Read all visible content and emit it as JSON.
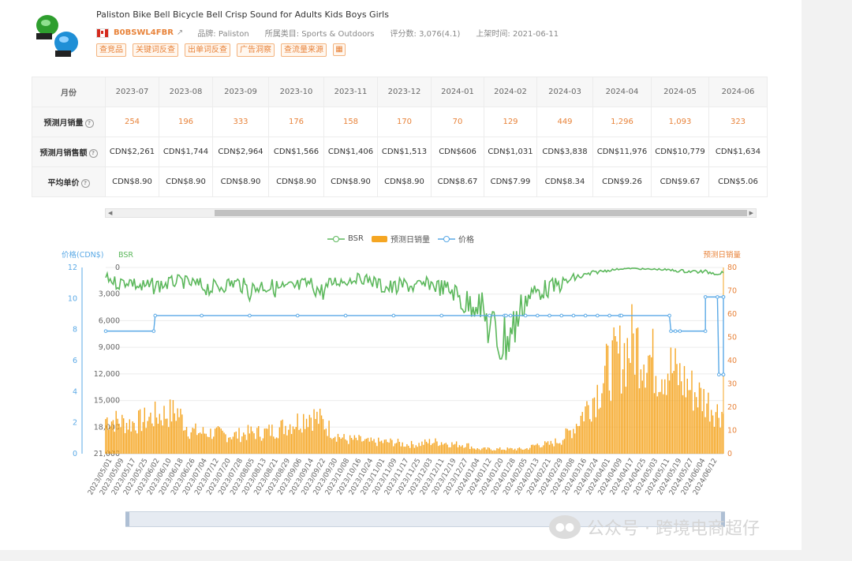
{
  "product": {
    "title": "Paliston Bike Bell Bicycle Bell Crisp Sound for Adults Kids Boys Girls",
    "asin": "B0BSWL4FBR",
    "brand": "品牌: Paliston",
    "category": "所属类目: Sports & Outdoors",
    "rating": "评分数: 3,076(4.1)",
    "listed": "上架时间: 2021-06-11",
    "tags": [
      "查竞品",
      "关键词反查",
      "出单词反查",
      "广告洞察",
      "查流量来源"
    ]
  },
  "table": {
    "header_label": "月份",
    "months": [
      "2023-07",
      "2023-08",
      "2023-09",
      "2023-10",
      "2023-11",
      "2023-12",
      "2024-01",
      "2024-02",
      "2024-03",
      "2024-04",
      "2024-05",
      "2024-06"
    ],
    "rows": [
      {
        "label": "预测月销量",
        "values": [
          "254",
          "196",
          "333",
          "176",
          "158",
          "170",
          "70",
          "129",
          "449",
          "1,296",
          "1,093",
          "323"
        ]
      },
      {
        "label": "预测月销售额",
        "values": [
          "CDN$2,261",
          "CDN$1,744",
          "CDN$2,964",
          "CDN$1,566",
          "CDN$1,406",
          "CDN$1,513",
          "CDN$606",
          "CDN$1,031",
          "CDN$3,838",
          "CDN$11,976",
          "CDN$10,779",
          "CDN$1,634"
        ]
      },
      {
        "label": "平均单价",
        "values": [
          "CDN$8.90",
          "CDN$8.90",
          "CDN$8.90",
          "CDN$8.90",
          "CDN$8.90",
          "CDN$8.90",
          "CDN$8.67",
          "CDN$7.99",
          "CDN$8.34",
          "CDN$9.26",
          "CDN$9.67",
          "CDN$5.06"
        ]
      }
    ]
  },
  "watermark": "公众号 · 跨境电商超仔",
  "chart_data": {
    "type": "line",
    "legend": [
      "BSR",
      "预测日销量",
      "价格"
    ],
    "axis_titles": {
      "price": "价格(CDN$)",
      "bsr": "BSR",
      "sales": "预测日销量"
    },
    "price_ticks": [
      "12",
      "10",
      "8",
      "6",
      "4",
      "2",
      "0"
    ],
    "bsr_ticks": [
      "0",
      "3,000",
      "6,000",
      "9,000",
      "12,000",
      "15,000",
      "18,000",
      "21,000"
    ],
    "sales_ticks": [
      "80",
      "70",
      "60",
      "50",
      "40",
      "30",
      "20",
      "10",
      "0"
    ],
    "price_range": [
      0,
      12
    ],
    "bsr_range": [
      0,
      21000
    ],
    "sales_range": [
      0,
      80
    ],
    "x_labels": [
      "2023/05/01",
      "2023/05/09",
      "2023/05/17",
      "2023/05/25",
      "2023/06/02",
      "2023/06/10",
      "2023/06/18",
      "2023/06/26",
      "2023/07/04",
      "2023/07/12",
      "2023/07/20",
      "2023/07/28",
      "2023/08/05",
      "2023/08/13",
      "2023/08/21",
      "2023/08/29",
      "2023/09/06",
      "2023/09/14",
      "2023/09/22",
      "2023/09/30",
      "2023/10/08",
      "2023/10/16",
      "2023/10/24",
      "2023/11/01",
      "2023/11/09",
      "2023/11/17",
      "2023/11/25",
      "2023/12/03",
      "2023/12/11",
      "2023/12/19",
      "2023/12/27",
      "2024/01/04",
      "2024/01/12",
      "2024/01/20",
      "2024/01/28",
      "2024/02/05",
      "2024/02/13",
      "2024/02/21",
      "2024/02/29",
      "2024/03/08",
      "2024/03/16",
      "2024/03/24",
      "2024/04/01",
      "2024/04/09",
      "2024/04/17",
      "2024/04/25",
      "2024/05/03",
      "2024/05/11",
      "2024/05/19",
      "2024/05/27",
      "2024/06/04",
      "2024/06/12"
    ],
    "colors": {
      "bsr": "#5cb85c",
      "sales": "#f5a623",
      "price": "#5aa9e6"
    },
    "series": [
      {
        "name": "BSR",
        "axis": "bsr",
        "values": [
          1100,
          1800,
          1500,
          2300,
          2100,
          1900,
          1500,
          1800,
          2100,
          2400,
          1900,
          1700,
          2600,
          2000,
          2300,
          2500,
          2200,
          1800,
          2800,
          1600,
          1500,
          1200,
          1400,
          2100,
          2400,
          1900,
          2300,
          1800,
          2300,
          2700,
          4200,
          3800,
          6800,
          8500,
          6900,
          3500,
          2700,
          2300,
          1900,
          1200,
          900,
          500,
          300,
          150,
          100,
          200,
          200,
          300,
          400,
          450,
          500,
          600
        ],
        "x": [
          0,
          8,
          16,
          24,
          32,
          40,
          48,
          56,
          64,
          72,
          80,
          88,
          96,
          104,
          112,
          120,
          128,
          136,
          144,
          152,
          160,
          168,
          176,
          184,
          192,
          200,
          208,
          216,
          224,
          232,
          240,
          248,
          256,
          264,
          272,
          280,
          288,
          296,
          304,
          312,
          320,
          328,
          336,
          344,
          352,
          360,
          368,
          376,
          384,
          392,
          400,
          408
        ]
      },
      {
        "name": "预测日销量",
        "axis": "sales",
        "values": [
          15,
          14,
          13,
          14,
          16,
          17,
          18,
          10,
          9,
          9,
          8,
          8,
          9,
          9,
          10,
          12,
          14,
          17,
          14,
          9,
          6,
          6,
          5,
          5,
          5,
          4,
          4,
          5,
          5,
          4,
          4,
          2,
          2,
          2,
          2,
          2,
          4,
          4,
          6,
          11,
          19,
          27,
          37,
          42,
          48,
          44,
          37,
          37,
          32,
          27,
          23,
          18
        ],
        "x": [
          0,
          8,
          16,
          24,
          32,
          40,
          48,
          56,
          64,
          72,
          80,
          88,
          96,
          104,
          112,
          120,
          128,
          136,
          144,
          152,
          160,
          168,
          176,
          184,
          192,
          200,
          208,
          216,
          224,
          232,
          240,
          248,
          256,
          264,
          272,
          280,
          288,
          296,
          304,
          312,
          320,
          328,
          336,
          344,
          352,
          360,
          368,
          376,
          384,
          392,
          400,
          408
        ]
      },
      {
        "name": "价格",
        "axis": "price",
        "values": [
          7.9,
          7.9,
          8.9,
          8.9,
          8.9,
          8.9,
          8.9,
          8.9,
          8.9,
          8.9,
          8.9,
          8.9,
          8.9,
          8.9,
          8.9,
          8.9,
          8.9,
          8.9,
          8.9,
          8.9,
          8.9,
          8.9,
          8.9,
          8.9,
          7.9,
          7.9,
          7.9,
          7.9,
          10.1,
          10.1,
          5.1,
          10.1,
          10.1,
          5.1,
          5.1
        ],
        "x": [
          0,
          32,
          33,
          64,
          96,
          128,
          160,
          192,
          224,
          256,
          266,
          267,
          270,
          280,
          288,
          296,
          304,
          312,
          320,
          328,
          336,
          343,
          344,
          376,
          377,
          380,
          383,
          400,
          400,
          412,
          412,
          412,
          408,
          409,
          412
        ]
      }
    ]
  }
}
